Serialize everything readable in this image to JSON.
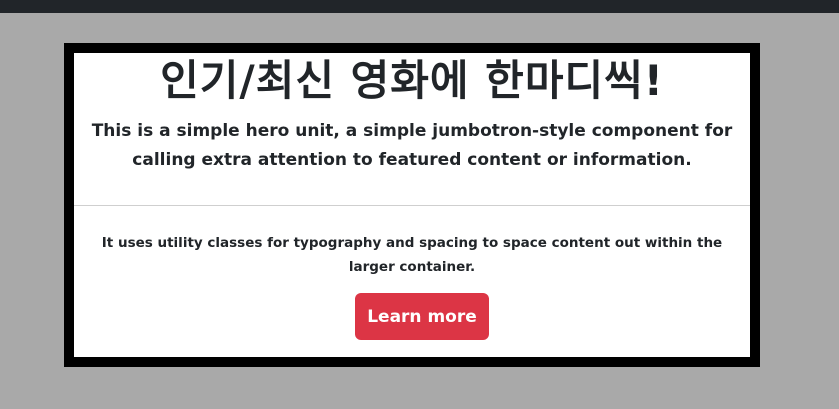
{
  "hero": {
    "title": "인기/최신 영화에 한마디씩!",
    "lead": "This is a simple hero unit, a simple jumbotron-style component for calling extra attention to featured content or information.",
    "body": "It uses utility classes for typography and spacing to space content out within the larger container.",
    "button_label": "Learn more"
  },
  "colors": {
    "page_background": "#a9a9a9",
    "top_bar": "#212529",
    "frame_border": "#000000",
    "panel_background": "#ffffff",
    "button": "#dc3545"
  }
}
